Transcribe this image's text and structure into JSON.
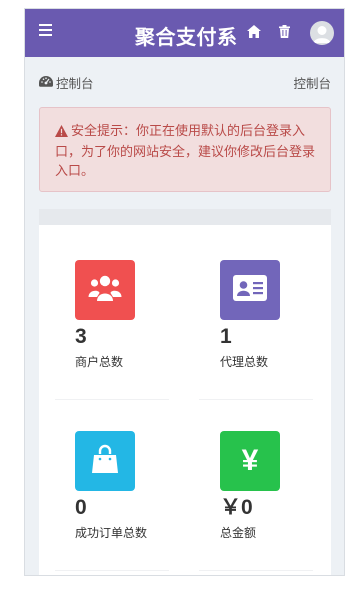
{
  "header": {
    "title": "聚合支付系",
    "colors": {
      "bar": "#6a5ab0"
    }
  },
  "breadcrumb": {
    "left_label": "控制台",
    "right_label": "控制台",
    "icon": "dashboard-icon"
  },
  "alert": {
    "icon": "warning-icon",
    "text": "安全提示：你正在使用默认的后台登录入口，为了你的网站安全，建议你修改后台登录入口。"
  },
  "stats": [
    {
      "value": "3",
      "label": "商户总数",
      "icon": "users-icon",
      "color": "#f05050"
    },
    {
      "value": "1",
      "label": "代理总数",
      "icon": "id-card-icon",
      "color": "#7266ba"
    },
    {
      "value": "0",
      "label": "成功订单总数",
      "icon": "shopping-bag-icon",
      "color": "#23b7e5"
    },
    {
      "value": "￥0",
      "label": "总金额",
      "icon": "yen-icon",
      "color": "#27c24c",
      "glyph": "¥"
    }
  ]
}
